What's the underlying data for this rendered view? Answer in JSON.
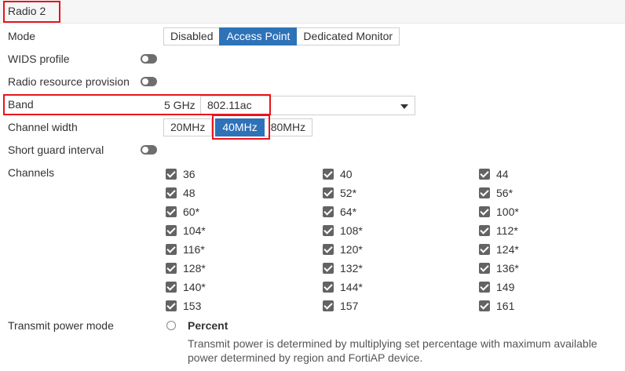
{
  "section": {
    "title": "Radio 2"
  },
  "mode": {
    "label": "Mode",
    "options": [
      {
        "label": "Disabled",
        "active": false
      },
      {
        "label": "Access Point",
        "active": true
      },
      {
        "label": "Dedicated Monitor",
        "active": false
      }
    ]
  },
  "wids": {
    "label": "WIDS profile",
    "enabled": false
  },
  "rrp": {
    "label": "Radio resource provision",
    "enabled": false
  },
  "band": {
    "label": "Band",
    "prefix": "5 GHz",
    "value": "802.11ac"
  },
  "channel_width": {
    "label": "Channel width",
    "options": [
      {
        "label": "20MHz",
        "active": false
      },
      {
        "label": "40MHz",
        "active": true
      },
      {
        "label": "80MHz",
        "active": false
      }
    ]
  },
  "sgi": {
    "label": "Short guard interval",
    "enabled": false
  },
  "channels": {
    "label": "Channels",
    "items": [
      {
        "label": "36",
        "checked": true
      },
      {
        "label": "40",
        "checked": true
      },
      {
        "label": "44",
        "checked": true
      },
      {
        "label": "48",
        "checked": true
      },
      {
        "label": "52*",
        "checked": true
      },
      {
        "label": "56*",
        "checked": true
      },
      {
        "label": "60*",
        "checked": true
      },
      {
        "label": "64*",
        "checked": true
      },
      {
        "label": "100*",
        "checked": true
      },
      {
        "label": "104*",
        "checked": true
      },
      {
        "label": "108*",
        "checked": true
      },
      {
        "label": "112*",
        "checked": true
      },
      {
        "label": "116*",
        "checked": true
      },
      {
        "label": "120*",
        "checked": true
      },
      {
        "label": "124*",
        "checked": true
      },
      {
        "label": "128*",
        "checked": true
      },
      {
        "label": "132*",
        "checked": true
      },
      {
        "label": "136*",
        "checked": true
      },
      {
        "label": "140*",
        "checked": true
      },
      {
        "label": "144*",
        "checked": true
      },
      {
        "label": "149",
        "checked": true
      },
      {
        "label": "153",
        "checked": true
      },
      {
        "label": "157",
        "checked": true
      },
      {
        "label": "161",
        "checked": true
      }
    ]
  },
  "transmit": {
    "label": "Transmit power mode",
    "option_label": "Percent",
    "selected": false,
    "description": "Transmit power is determined by multiplying set percentage with maximum available power determined by region and FortiAP device."
  },
  "colors": {
    "accent": "#2e72b8",
    "highlight": "#e8141d",
    "toggle_off": "#6e6e6e",
    "checkbox": "#636363"
  }
}
